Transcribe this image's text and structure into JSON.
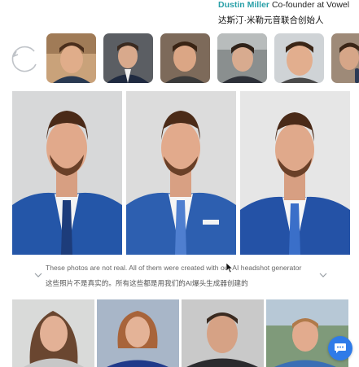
{
  "header": {
    "name": "Dustin Miller",
    "role": "Co-founder at Vowel",
    "role_zh": "达斯汀·米勒元音联合创始人"
  },
  "selfies": [
    {
      "label": "selfie-1"
    },
    {
      "label": "selfie-2"
    },
    {
      "label": "selfie-3"
    },
    {
      "label": "selfie-4"
    },
    {
      "label": "selfie-5"
    },
    {
      "label": "selfie-6"
    }
  ],
  "caption": {
    "en": "These photos are not real. All of them were created with our AI headshot generator",
    "zh": "这些照片不是真实的。所有这些都是用我们的AI爆头生成器创建的"
  },
  "colors": {
    "accent": "#2aa0a8",
    "suit_blue": "#2456a8",
    "chat_button": "#2f7be8"
  },
  "icons": {
    "refresh": "refresh-icon",
    "chat": "chat-icon",
    "chevron_left": "chevron-down-icon",
    "chevron_right": "chevron-down-icon"
  }
}
